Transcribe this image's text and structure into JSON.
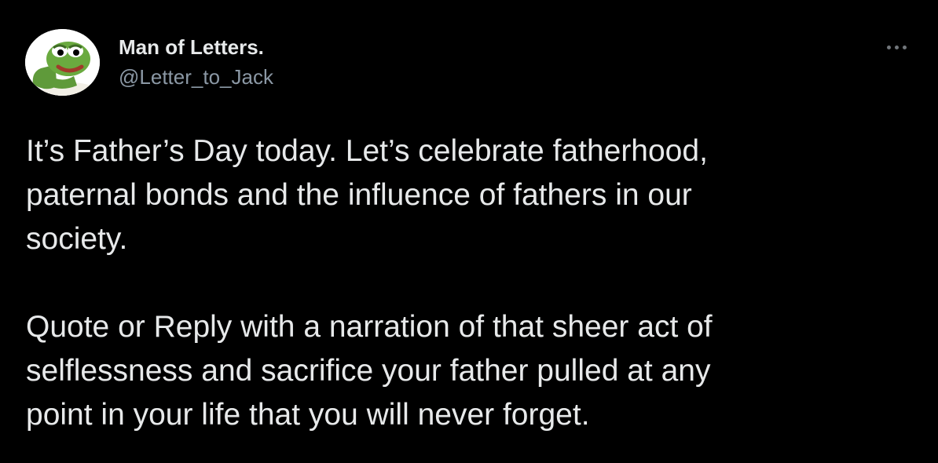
{
  "tweet": {
    "author": {
      "display_name": "Man of Letters.",
      "handle": "@Letter_to_Jack",
      "avatar_icon": "pepe-frog-avatar"
    },
    "more_icon": "more-dots-icon",
    "text_paragraphs": [
      "It’s Father’s Day today. Let’s celebrate fatherhood,\npaternal bonds and the influence of fathers in our\nsociety.",
      "Quote or Reply with a narration of that sheer act of\nselflessness and sacrifice your father pulled at any\npoint in your life that you will never forget."
    ]
  },
  "colors": {
    "background": "#000000",
    "primary_text": "#e7e9ea",
    "secondary_text": "#8b98a5"
  }
}
